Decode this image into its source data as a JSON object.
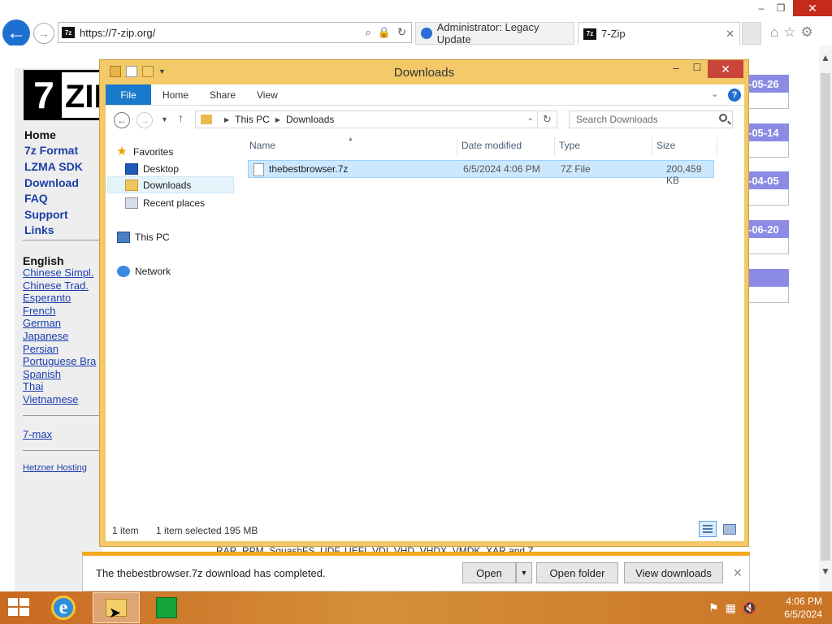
{
  "browser": {
    "url": "https://7-zip.org/",
    "tabs": [
      {
        "label": "Administrator: Legacy Update"
      },
      {
        "label": "7-Zip"
      }
    ],
    "favicon_text": "7z",
    "window_controls": {
      "minimize": "–",
      "maximize": "❐",
      "close": "✕"
    }
  },
  "website": {
    "logo": {
      "seven": "7",
      "zip": "ZIP"
    },
    "nav": [
      "Home",
      "7z Format",
      "LZMA SDK",
      "Download",
      "FAQ",
      "Support",
      "Links"
    ],
    "language_heading": "English",
    "languages": [
      "Chinese Simpl.",
      "Chinese Trad.",
      "Esperanto",
      "French",
      "German",
      "Japanese",
      "Persian",
      "Portuguese Bra",
      "Spanish",
      "Thai",
      "Vietnamese"
    ],
    "max_link": "7-max",
    "hosting_link": "Hetzner Hosting",
    "news_dates": [
      "-05-26",
      "-05-14",
      "-04-05",
      "-06-20"
    ],
    "bottom_text": "RAR, RPM, SquashFS, UDF, UEFI, VDI, VHD, VHDX, VMDK, XAR and Z."
  },
  "explorer": {
    "title": "Downloads",
    "ribbon_tabs": [
      "File",
      "Home",
      "Share",
      "View"
    ],
    "path": [
      "This PC",
      "Downloads"
    ],
    "search_placeholder": "Search Downloads",
    "nav_pane": {
      "favorites": "Favorites",
      "desktop": "Desktop",
      "downloads": "Downloads",
      "recent": "Recent places",
      "this_pc": "This PC",
      "network": "Network"
    },
    "columns": [
      "Name",
      "Date modified",
      "Type",
      "Size"
    ],
    "files": [
      {
        "name": "thebestbrowser.7z",
        "date": "6/5/2024 4:06 PM",
        "type": "7Z File",
        "size": "200,459 KB"
      }
    ],
    "status": {
      "count": "1 item",
      "selected": "1 item selected  195 MB"
    }
  },
  "download_bar": {
    "message": "The thebestbrowser.7z download has completed.",
    "open": "Open",
    "open_folder": "Open folder",
    "view_downloads": "View downloads"
  },
  "taskbar": {
    "time": "4:06 PM",
    "date": "6/5/2024"
  },
  "colors": {
    "explorer_frame": "#f3c969",
    "file_tab": "#1979ca",
    "selection": "#cce8ff",
    "download_accent": "#f4a81c",
    "site_link": "#1a3dae",
    "news_header": "#8b8be6"
  }
}
